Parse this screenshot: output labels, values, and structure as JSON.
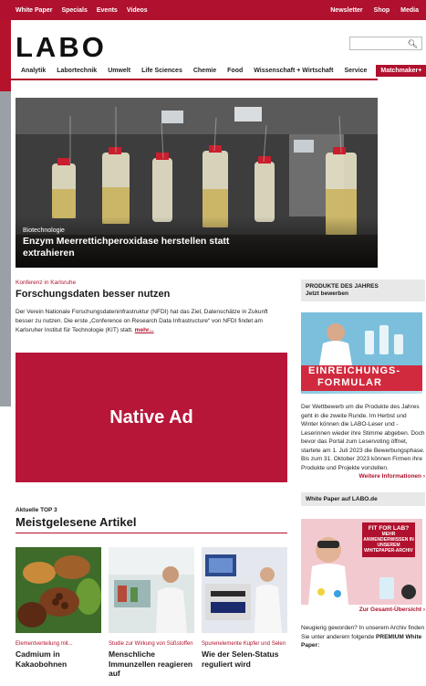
{
  "topbar": {
    "left_items": [
      "White Paper",
      "Specials",
      "Events",
      "Videos"
    ],
    "right_items": [
      "Newsletter",
      "Shop",
      "Media"
    ]
  },
  "logo": "LABO",
  "search": {
    "placeholder": ""
  },
  "nav": {
    "items": [
      "Analytik",
      "Labortechnik",
      "Umwelt",
      "Life Sciences",
      "Chemie",
      "Food",
      "Wissenschaft + Wirtschaft",
      "Service"
    ],
    "cta": "Matchmaker+"
  },
  "hero": {
    "category": "Biotechnologie",
    "title": "Enzym Meerrettichperoxidase herstellen statt extrahieren"
  },
  "lead_article": {
    "kicker": "Konferenz in Karlsruhe",
    "title": "Forschungsdaten besser nutzen",
    "body": "Der Verein Nationale Forschungsdateninfrastruktur (NFDI) hat das Ziel, Datenschätze in Zukunft besser zu nutzen. Die erste „Conference on Research Data Infrastructure“ von NFDI findet am Karlsruher Institut für Technologie (KIT) statt.",
    "more": "mehr..."
  },
  "native_ad": {
    "label": "Native Ad"
  },
  "top3": {
    "small_title": "Aktuelle TOP 3",
    "title": "Meistgelesene Artikel",
    "articles": [
      {
        "kicker": "Elementverteilung mit...",
        "title": "Cadmium in Kakaobohnen"
      },
      {
        "kicker": "Studie zur Wirkung von Süßstoffen",
        "title": "Menschliche Immunzellen reagieren auf"
      },
      {
        "kicker": "Spurenelemente Kupfer und Selen",
        "title": "Wie der Selen-Status reguliert wird"
      }
    ]
  },
  "sidebar": {
    "products": {
      "heading": "PRODUKTE DES JAHRES",
      "subheading": "Jetzt bewerben",
      "banner_line1": "EINREICHUNGS-",
      "banner_line2": "FORMULAR",
      "text": "Der Wettbewerb um die Produkte des Jahres geht in die zweite Runde. Im Herbst und Winter können die LABO-Leser und -Leserinnen wieder ihre Stimme abgeben. Doch bevor das Portal zum Leservoting öffnet, startete am 1. Juli 2023 die Bewerbungsphase. Bis zum 31. Oktober 2023 können Firmen ihre Produkte und Projekte vorstellen.",
      "link": "Weitere Informationen"
    },
    "whitepaper": {
      "heading": "White Paper auf LABO.de",
      "box_title": "FIT FOR LAB?",
      "box_text": "MEHR ANWENDERWISSEN IN UNSEREM WHITEPAPER-ARCHIV",
      "link": "Zur Gesamt-Übersicht",
      "text_plain": "Neugierig geworden? In unserem Archiv finden Sie unter anderem folgende",
      "text_bold": "PREMIUM White Paper:"
    }
  },
  "colors": {
    "brand": "#b0112e",
    "native_ad": "#b71638"
  }
}
